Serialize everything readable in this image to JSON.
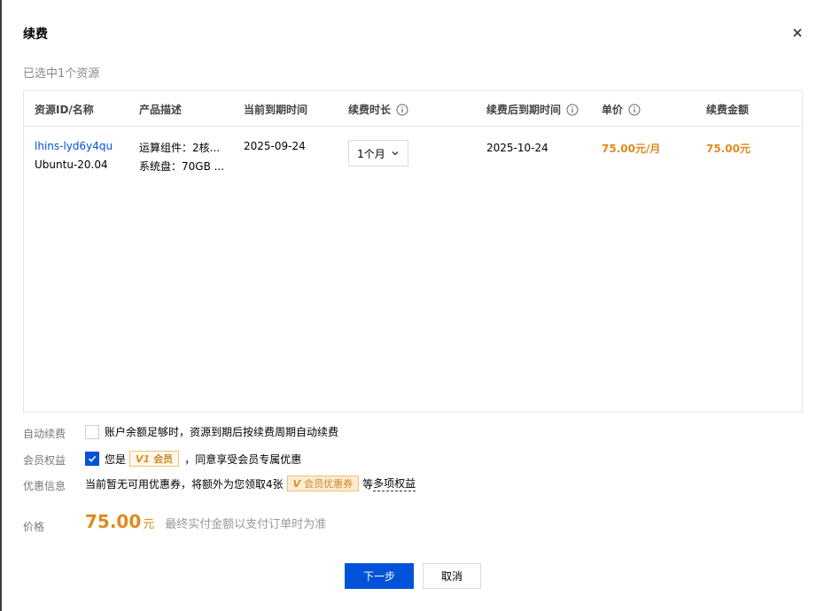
{
  "dialog": {
    "title": "续费",
    "selected_text": "已选中1个资源"
  },
  "table": {
    "headers": {
      "id_name": "资源ID/名称",
      "desc": "产品描述",
      "expire": "当前到期时间",
      "duration": "续费时长",
      "new_expire": "续费后到期时间",
      "unit_price": "单价",
      "amount": "续费金额"
    },
    "rows": [
      {
        "id": "lhins-lyd6y4qu",
        "name": "Ubuntu-20.04",
        "desc_line1": "运算组件：2核...",
        "desc_line2": "系统盘：70GB ...",
        "expire": "2025-09-24",
        "duration": "1个月",
        "new_expire": "2025-10-24",
        "unit_price": "75.00元/月",
        "amount": "75.00元"
      }
    ]
  },
  "auto_renew": {
    "label": "自动续费",
    "text": "账户余额足够时，资源到期后按续费周期自动续费",
    "checked": false
  },
  "member": {
    "label": "会员权益",
    "prefix": "您是",
    "tag_v": "V1",
    "tag_text": "会员",
    "suffix": "，同意享受会员专属优惠",
    "checked": true
  },
  "discount": {
    "label": "优惠信息",
    "text": "当前暂无可用优惠券，将额外为您领取4张",
    "tag_v": "V",
    "tag_text": "会员优惠券",
    "suffix_plain": "等",
    "suffix_link": "多项权益"
  },
  "price": {
    "label": "价格",
    "value": "75.00",
    "unit": "元",
    "note": "最终实付金额以支付订单时为准"
  },
  "buttons": {
    "next": "下一步",
    "cancel": "取消"
  },
  "colors": {
    "primary": "#0052d9",
    "price": "#e08a1e",
    "vip_border": "#f0c07a"
  },
  "icons": {
    "close": "close-icon",
    "info": "info-circle-icon",
    "chevron": "chevron-down-icon",
    "check": "check-icon"
  }
}
